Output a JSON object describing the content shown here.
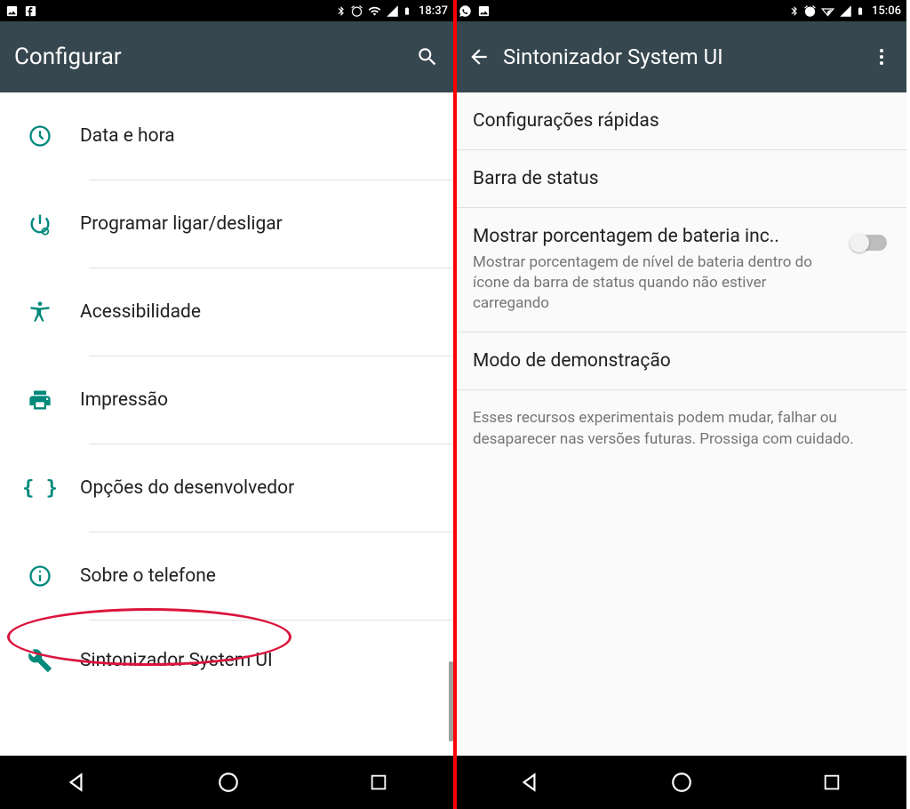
{
  "left": {
    "status": {
      "time": "18:37"
    },
    "app_bar": {
      "title": "Configurar"
    },
    "items": [
      {
        "label": "Data e hora"
      },
      {
        "label": "Programar ligar/desligar"
      },
      {
        "label": "Acessibilidade"
      },
      {
        "label": "Impressão"
      },
      {
        "label": "Opções do desenvolvedor"
      },
      {
        "label": "Sobre o telefone"
      },
      {
        "label": "Sintonizador System UI"
      }
    ]
  },
  "right": {
    "status": {
      "time": "15:06"
    },
    "app_bar": {
      "title": "Sintonizador System UI"
    },
    "rows": {
      "quick": "Configurações rápidas",
      "statusbar": "Barra de status",
      "battery_title": "Mostrar porcentagem de bateria inc..",
      "battery_desc": "Mostrar porcentagem de nível de bateria dentro do ícone da barra de status quando não estiver carregando",
      "demo": "Modo de demonstração",
      "footer": "Esses recursos experimentais podem mudar, falhar ou desaparecer nas versões futuras. Prossiga com cuidado."
    }
  }
}
